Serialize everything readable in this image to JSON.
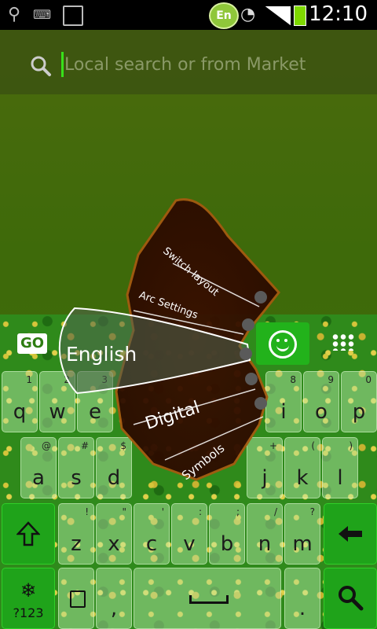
{
  "status_bar": {
    "time": "12:10",
    "lang_badge": "En",
    "icons": [
      "usb-icon",
      "keyboard-icon",
      "sim-icon",
      "wifi-icon",
      "signal-icon",
      "battery-icon"
    ]
  },
  "search": {
    "placeholder": "Local search or from Market",
    "icon": "search-icon"
  },
  "keyboard": {
    "logo": "GO",
    "rows": [
      [
        {
          "key": "q",
          "sub": "1"
        },
        {
          "key": "w",
          "sub": "2"
        },
        {
          "key": "e",
          "sub": "3"
        },
        {
          "key": "i",
          "sub": "8"
        },
        {
          "key": "o",
          "sub": "9"
        },
        {
          "key": "p",
          "sub": "0"
        }
      ],
      [
        {
          "key": "a",
          "sub": "@"
        },
        {
          "key": "s",
          "sub": "#"
        },
        {
          "key": "d",
          "sub": "$"
        },
        {
          "key": "j",
          "sub": "+"
        },
        {
          "key": "k",
          "sub": "("
        },
        {
          "key": "l",
          "sub": ")"
        }
      ],
      [
        {
          "key": "z",
          "sub": "!"
        },
        {
          "key": "x",
          "sub": "\""
        },
        {
          "key": "c",
          "sub": "'"
        },
        {
          "key": "v",
          "sub": ":"
        },
        {
          "key": "b",
          "sub": ";"
        },
        {
          "key": "n",
          "sub": "/"
        },
        {
          "key": "m",
          "sub": "?"
        }
      ]
    ],
    "bottom": {
      "symbols_key": "?123",
      "comma_key": ",",
      "period_key": "."
    }
  },
  "arc_menu": {
    "items": [
      "Switch layout",
      "Arc Settings",
      "English",
      "Digital",
      "Symbols"
    ],
    "selected": "English"
  }
}
